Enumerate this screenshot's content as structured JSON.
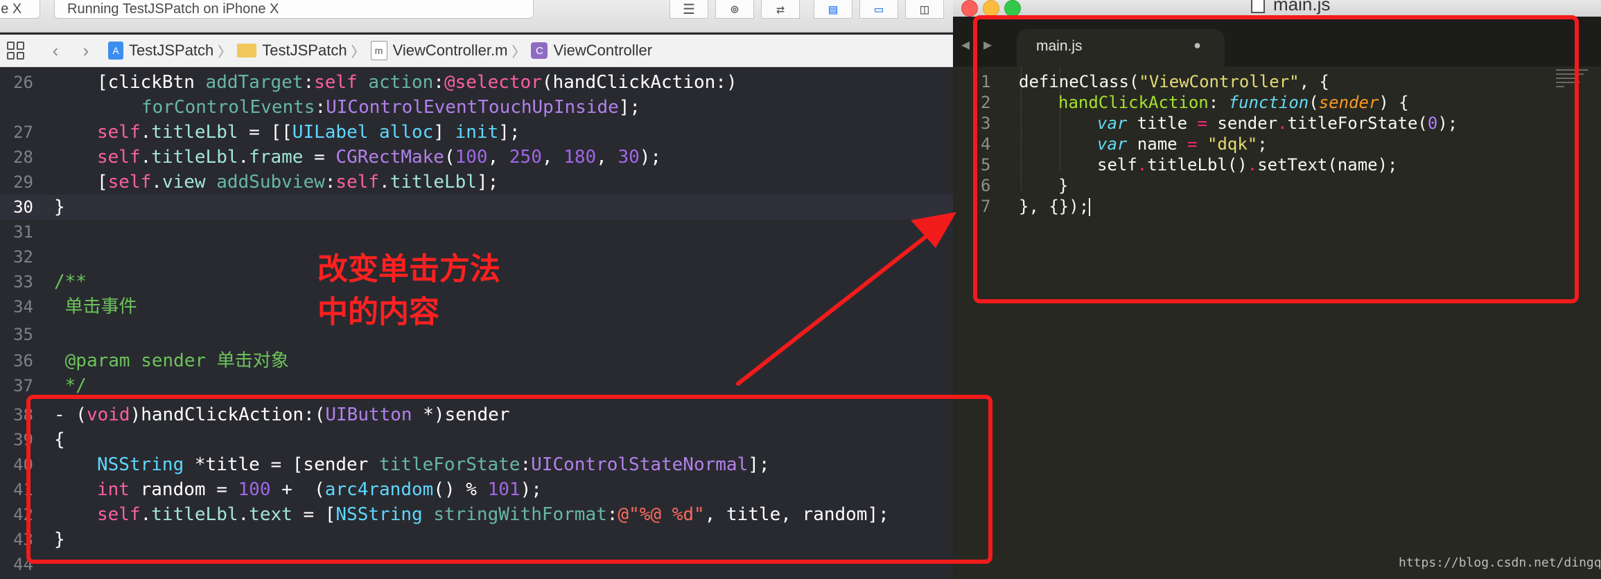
{
  "xcode": {
    "toolbar": {
      "scheme_partial": "one X",
      "status": "Running TestJSPatch on  iPhone X"
    },
    "jumpbar": {
      "items": [
        "TestJSPatch",
        "TestJSPatch",
        "ViewController.m",
        "ViewController"
      ],
      "icon_letters": [
        "",
        "",
        "m",
        "C"
      ]
    },
    "line_numbers": [
      "26",
      "27",
      "28",
      "29",
      "30",
      "31",
      "32",
      "33",
      "34",
      "35",
      "36",
      "37",
      "38",
      "39",
      "40",
      "41",
      "42",
      "43",
      "44"
    ],
    "code": {
      "l26a": [
        "[clickBtn ",
        "addTarget",
        ":",
        "self",
        " ",
        "action",
        ":",
        "@selector",
        "(handClickAction:)"
      ],
      "l26b": [
        "forControlEvents",
        ":",
        "UIControlEventTouchUpInside",
        "];"
      ],
      "l27": [
        "self",
        ".",
        "titleLbl",
        " = [[",
        "UILabel",
        " ",
        "alloc",
        "] ",
        "init",
        "];"
      ],
      "l28": [
        "self",
        ".",
        "titleLbl",
        ".",
        "frame",
        " = ",
        "CGRectMake",
        "(",
        "100",
        ", ",
        "250",
        ", ",
        "180",
        ", ",
        "30",
        ");"
      ],
      "l29": [
        "[",
        "self",
        ".",
        "view",
        " ",
        "addSubview",
        ":",
        "self",
        ".",
        "titleLbl",
        "];"
      ],
      "l30": "}",
      "l33": "/**",
      "l34": " 单击事件",
      "l36": " @param sender 单击对象",
      "l37": " */",
      "l38": [
        "- (",
        "void",
        ")handClickAction:(",
        "UIButton",
        " *)sender"
      ],
      "l39": "{",
      "l40": [
        "NSString",
        " *title = [sender ",
        "titleForState",
        ":",
        "UIControlStateNormal",
        "];"
      ],
      "l41": [
        "int",
        " random = ",
        "100",
        " +  (",
        "arc4random",
        "() % ",
        "101",
        ");"
      ],
      "l42": [
        "self",
        ".",
        "titleLbl",
        ".",
        "text",
        " = [",
        "NSString",
        " ",
        "stringWithFormat",
        ":",
        "@\"%@ %d\"",
        ", title, random];"
      ],
      "l43": "}"
    }
  },
  "sublime": {
    "window_title": "main.js",
    "tab_label": "main.js",
    "tab_dirty_marker": "●",
    "line_numbers": [
      "1",
      "2",
      "3",
      "4",
      "5",
      "6",
      "7"
    ],
    "code": {
      "l1": [
        "defineClass",
        "(",
        "\"ViewController\"",
        ", {"
      ],
      "l2": [
        "handClickAction",
        ": ",
        "function",
        "(",
        "sender",
        ") {"
      ],
      "l3": [
        "var",
        " title ",
        "=",
        " sender",
        ".",
        "titleForState(",
        "0",
        ");"
      ],
      "l4": [
        "var",
        " name ",
        "=",
        " ",
        "\"dqk\"",
        ";"
      ],
      "l5": [
        "self",
        ".",
        "titleLbl()",
        ".",
        "setText(name);"
      ],
      "l6": "}",
      "l7": "}, {});"
    }
  },
  "annotation": {
    "line1": "改变单击方法",
    "line2": "中的内容",
    "color": "#ff2020"
  },
  "watermark": "https://blog.csdn.net/dingqk",
  "colors": {
    "xcode_bg": "#292a30",
    "sublime_bg": "#272822",
    "highlight_red": "#f21b1b"
  }
}
